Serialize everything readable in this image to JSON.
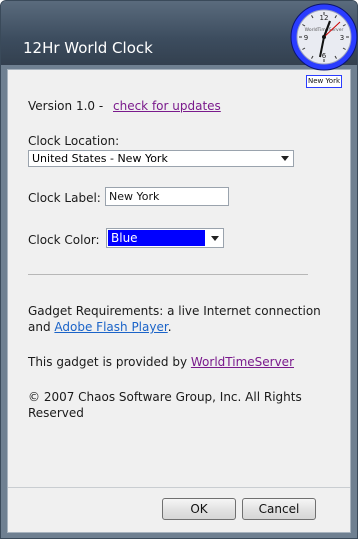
{
  "window": {
    "title": "12Hr World Clock"
  },
  "version": {
    "text": "Version 1.0 -",
    "update_link": "check for updates"
  },
  "location": {
    "label": "Clock Location:",
    "value": "United States - New York"
  },
  "clock_label": {
    "label": "Clock Label:",
    "value": "New York"
  },
  "clock_color": {
    "label": "Clock Color:",
    "value": "Blue",
    "swatch_color": "#0000ff"
  },
  "requirements": {
    "line1": "Gadget Requirements: a live Internet connection",
    "and": "and",
    "flash_link": "Adobe Flash Player",
    "period": "."
  },
  "provider": {
    "text": "This gadget is provided by",
    "link": "WorldTimeServer"
  },
  "copyright": {
    "line1": "© 2007 Chaos Software Group, Inc. All Rights",
    "line2": "Reserved"
  },
  "buttons": {
    "ok": "OK",
    "cancel": "Cancel"
  },
  "gadget": {
    "brand": "WorldTimeServer",
    "city": "New York",
    "numbers": [
      "12",
      "3",
      "6",
      "9"
    ],
    "ring_color": "#1f2fff"
  }
}
